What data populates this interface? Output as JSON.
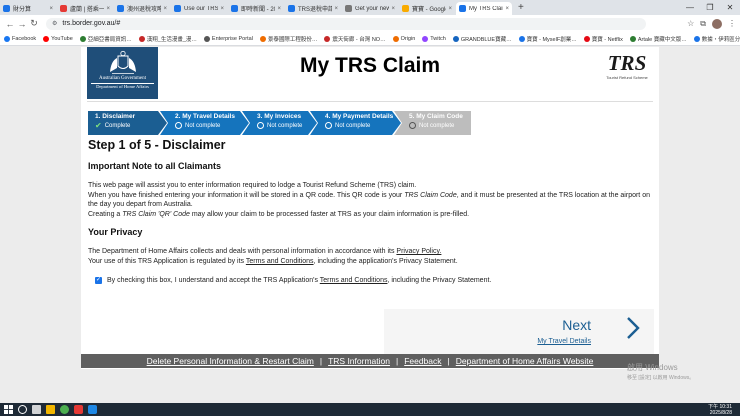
{
  "browser": {
    "tabs": [
      {
        "label": "財分算",
        "color": "#1a73e8",
        "active": false
      },
      {
        "label": "盧蘭 | 搭乘一票到…",
        "color": "#e53935",
        "active": false
      },
      {
        "label": "澳州退稅攻略 | 澳…",
        "color": "#1a73e8",
        "active": false
      },
      {
        "label": "Use our TRS app",
        "color": "#1a73e8",
        "active": false
      },
      {
        "label": "即時新聞 - 2025 市…",
        "color": "#1a73e8",
        "active": false
      },
      {
        "label": "TRS退稅申請步驟…",
        "color": "#1a73e8",
        "active": false
      },
      {
        "label": "Get your new iPad…",
        "color": "#777777",
        "active": false
      },
      {
        "label": "寶寶 - Google 雲端…",
        "color": "#f9ab00",
        "active": false
      },
      {
        "label": "My TRS Claim",
        "color": "#1a73e8",
        "active": true
      }
    ],
    "new_tab_glyph": "+",
    "window_controls": [
      "—",
      "❐",
      "✕"
    ],
    "nav": {
      "back": "←",
      "forward": "→",
      "reload": "↻"
    },
    "url": "trs.border.gov.au/#",
    "lock_glyph": "⚙",
    "toolbar_right": [
      "☆",
      "⧉",
      "⋮"
    ],
    "bookmarks": [
      {
        "label": "Facebook",
        "color": "#1877f2"
      },
      {
        "label": "YouTube",
        "color": "#ff0000"
      },
      {
        "label": "亞細亞書局資訊…",
        "color": "#2e7d32"
      },
      {
        "label": "漢翔_生活漫畫_漫…",
        "color": "#c62828"
      },
      {
        "label": "Enterprise Portal",
        "color": "#555555"
      },
      {
        "label": "景泰國際工程股份…",
        "color": "#ef6c00"
      },
      {
        "label": "震天街廊 - 台灣 NO…",
        "color": "#c62828"
      },
      {
        "label": "Origin",
        "color": "#ef6c00"
      },
      {
        "label": "Twitch",
        "color": "#9146ff"
      },
      {
        "label": "GRANDBLUE寶藏…",
        "color": "#1565c0"
      },
      {
        "label": "寶寶 - MyselF創業…",
        "color": "#1a73e8"
      },
      {
        "label": "寶寶 - Netflix",
        "color": "#e50914"
      },
      {
        "label": "Artale 寶藏中文版…",
        "color": "#2e7d32"
      },
      {
        "label": "數據・伊莉區分區",
        "color": "#1a73e8"
      }
    ],
    "bookmarks_more": "»"
  },
  "header": {
    "gov_line1": "Australian Government",
    "gov_line2": "Department of Home Affairs",
    "title": "My TRS Claim",
    "trs_logo": "TRS",
    "trs_tagline": "Tourist Refund Scheme"
  },
  "steps": [
    {
      "title": "1. Disclaimer",
      "status": "Complete",
      "state": "complete"
    },
    {
      "title": "2. My Travel Details",
      "status": "Not complete",
      "state": "incomplete"
    },
    {
      "title": "3. My Invoices",
      "status": "Not complete",
      "state": "incomplete"
    },
    {
      "title": "4. My Payment Details",
      "status": "Not complete",
      "state": "incomplete"
    },
    {
      "title": "5. My Claim Code",
      "status": "Not complete",
      "state": "disabled"
    }
  ],
  "content": {
    "heading": "Step 1 of 5 - Disclaimer",
    "note_heading": "Important Note to all Claimants",
    "p1": "This web page will assist you to enter information required to lodge a Tourist Refund Scheme (TRS) claim.",
    "p2_a": "When you have finished entering your information it will be stored in a QR code. This QR code is your ",
    "p2_em": "TRS Claim Code",
    "p2_b": ", and it must be presented at the TRS location at the airport on the day you depart from Australia.",
    "p3_a": "Creating a ",
    "p3_em": "TRS Claim 'QR' Code",
    "p3_b": " may allow your claim to be processed faster at TRS as your claim information is pre-filled.",
    "privacy_heading": "Your Privacy",
    "p4_a": "The Department of Home Affairs collects and deals with personal information in accordance with its ",
    "p4_link": "Privacy Policy.",
    "p5_a": "Your use of this TRS Application is regulated by its ",
    "p5_link": "Terms and Conditions",
    "p5_b": ", including the application's Privacy Statement.",
    "accept_a": "By checking this box, I understand and accept the TRS Application's ",
    "accept_link": "Terms and Conditions",
    "accept_b": ", including the Privacy Statement.",
    "accept_checked": true
  },
  "next": {
    "label": "Next",
    "sub": "My Travel Details"
  },
  "footer": {
    "links": [
      "Delete Personal Information & Restart Claim",
      "TRS Information",
      "Feedback",
      "Department of Home Affairs Website"
    ],
    "separator": "|"
  },
  "watermark": {
    "line1": "啟用 Windows",
    "line2": "移至 [設定] 以啟用 Windows。"
  },
  "taskbar": {
    "time": "下午 10:31",
    "date": "2025/8/28"
  },
  "colors": {
    "step_active": "#1b5e92",
    "step": "#1574bd",
    "step_disabled": "#bdbdbd",
    "footer": "#5f5f5f"
  }
}
